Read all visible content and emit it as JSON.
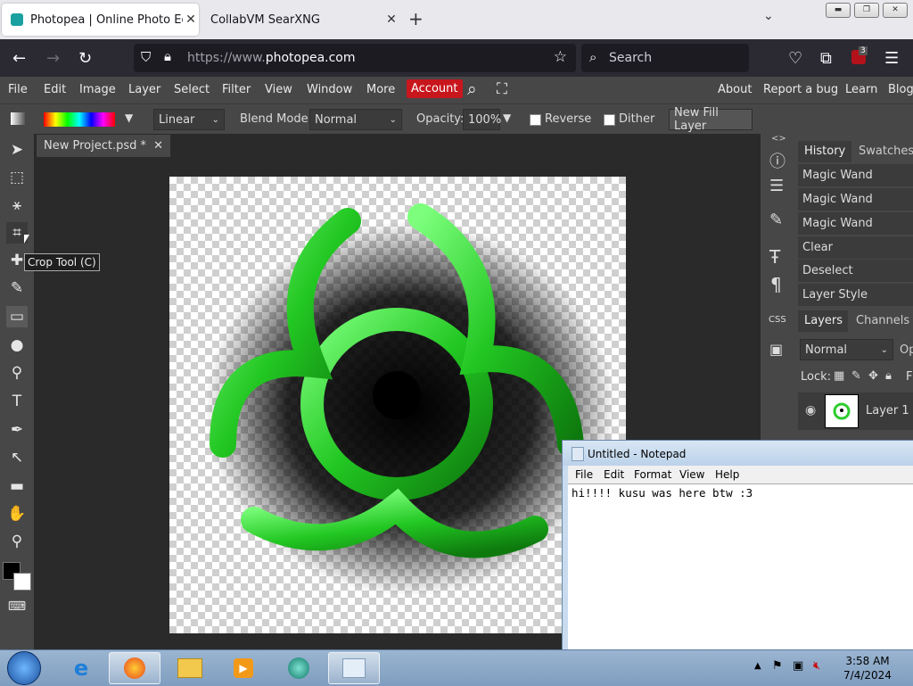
{
  "browser": {
    "tabs": [
      {
        "title": "Photopea | Online Photo Editor",
        "active": true
      },
      {
        "title": "CollabVM SearXNG",
        "active": false
      }
    ],
    "url_scheme": "https://www.",
    "url_host": "photopea.com",
    "search_placeholder": "Search",
    "badge_count": "3"
  },
  "photopea": {
    "menu": [
      "File",
      "Edit",
      "Image",
      "Layer",
      "Select",
      "Filter",
      "View",
      "Window",
      "More"
    ],
    "account_label": "Account",
    "right_menu": [
      "About",
      "Report a bug",
      "Learn",
      "Blog"
    ],
    "options": {
      "gradient_type": "Linear",
      "blend_mode_label": "Blend Mode:",
      "blend_mode": "Normal",
      "opacity_label": "Opacity:",
      "opacity": "100%",
      "reverse_label": "Reverse",
      "dither_label": "Dither",
      "new_fill_layer_label": "New Fill Layer"
    },
    "doc_tab": "New Project.psd *",
    "tooltip": "Crop Tool (C)",
    "history_tabs": [
      "History",
      "Swatches"
    ],
    "history_items": [
      "Magic Wand",
      "Magic Wand",
      "Magic Wand",
      "Clear",
      "Deselect",
      "Layer Style"
    ],
    "layer_tabs": [
      "Layers",
      "Channels"
    ],
    "layer_blend": "Normal",
    "layer_opacity_stub": "Op",
    "lock_label": "Lock:",
    "lock_fill_stub": "F",
    "layer_name": "Layer 1",
    "icons": {
      "move": "move-icon",
      "marquee": "marquee-icon",
      "magic-wand": "magic-wand-icon",
      "crop": "crop-icon",
      "brush": "brush-icon",
      "type": "type-icon",
      "hand": "hand-icon",
      "zoom": "zoom-icon"
    },
    "accent_red": "#c8161d",
    "symbol_green": "#2ecc2e"
  },
  "notepad": {
    "title": "Untitled - Notepad",
    "menu": [
      "File",
      "Edit",
      "Format",
      "View",
      "Help"
    ],
    "text": "hi!!!! kusu was here btw :3"
  },
  "taskbar": {
    "time": "3:58 AM",
    "date": "7/4/2024"
  }
}
